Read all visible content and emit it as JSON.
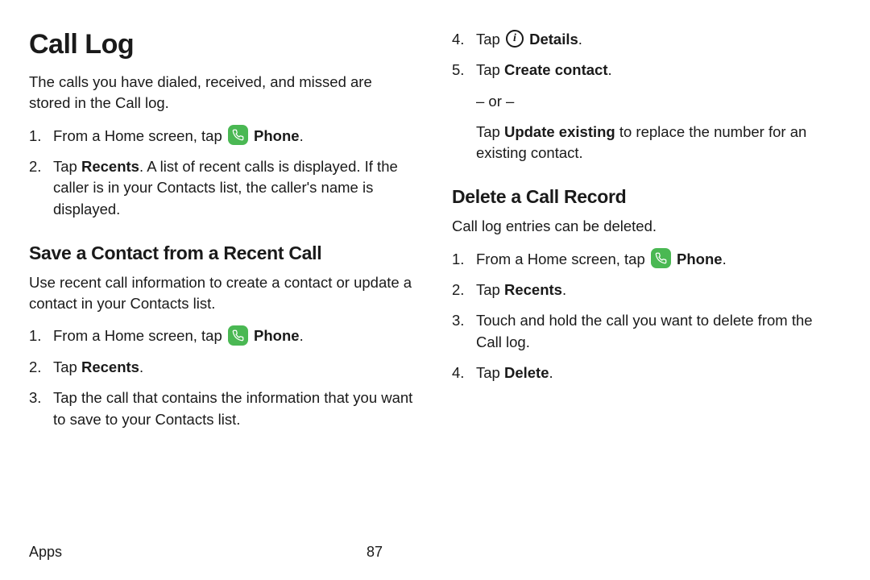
{
  "left": {
    "h1": "Call Log",
    "intro": "The calls you have dialed, received, and missed are stored in the Call log.",
    "steps_a": {
      "s1_pre": "From a Home screen, tap ",
      "s1_bold": "Phone",
      "s1_post": ".",
      "s2_pre": "Tap ",
      "s2_bold": "Recents",
      "s2_post": ". A list of recent calls is displayed. If the caller is in your Contacts list, the caller's name is displayed."
    },
    "h2": "Save a Contact from a Recent Call",
    "intro2": "Use recent call information to create a contact or update a contact in your Contacts list.",
    "steps_b": {
      "s1_pre": "From a Home screen, tap ",
      "s1_bold": "Phone",
      "s1_post": ".",
      "s2_pre": "Tap ",
      "s2_bold": "Recents",
      "s2_post": ".",
      "s3": "Tap the call that contains the information that you want to save to your Contacts list."
    }
  },
  "right": {
    "steps_c": {
      "s4_pre": "Tap ",
      "s4_bold": "Details",
      "s4_post": ".",
      "s5_pre": "Tap ",
      "s5_bold": "Create contact",
      "s5_post": ".",
      "or": "– or –",
      "alt_pre": "Tap ",
      "alt_bold": "Update existing",
      "alt_post": " to replace the number for an existing contact."
    },
    "h2": "Delete a Call Record",
    "intro": "Call log entries can be deleted.",
    "steps_d": {
      "s1_pre": "From a Home screen, tap ",
      "s1_bold": "Phone",
      "s1_post": ".",
      "s2_pre": "Tap ",
      "s2_bold": "Recents",
      "s2_post": ".",
      "s3": "Touch and hold the call you want to delete from the Call log.",
      "s4_pre": "Tap ",
      "s4_bold": "Delete",
      "s4_post": "."
    }
  },
  "footer": {
    "section": "Apps",
    "page": "87"
  },
  "icons": {
    "phone": "phone-icon",
    "info": "info-icon"
  }
}
